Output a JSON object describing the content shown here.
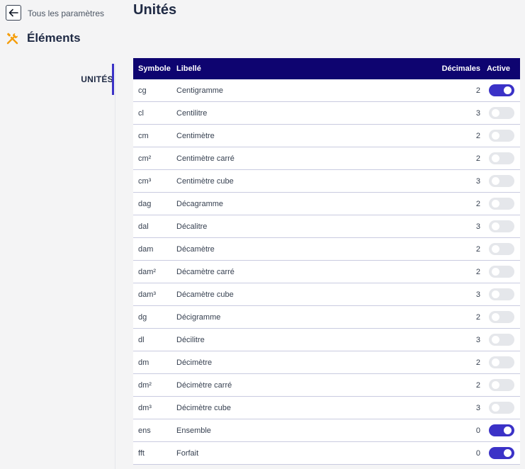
{
  "header": {
    "back_label": "Tous les paramètres",
    "page_title": "Unités",
    "section_title": "Éléments",
    "section_icon": "tools-icon"
  },
  "sidenav": {
    "items": [
      {
        "label": "UNITÉS",
        "active": true
      }
    ]
  },
  "table": {
    "columns": {
      "symbol": "Symbole",
      "label": "Libellé",
      "decimals": "Décimales",
      "active": "Active"
    },
    "rows": [
      {
        "symbol": "cg",
        "label": "Centigramme",
        "decimals": "2",
        "active": true
      },
      {
        "symbol": "cl",
        "label": "Centilitre",
        "decimals": "3",
        "active": false
      },
      {
        "symbol": "cm",
        "label": "Centimètre",
        "decimals": "2",
        "active": false
      },
      {
        "symbol": "cm²",
        "label": "Centimètre carré",
        "decimals": "2",
        "active": false
      },
      {
        "symbol": "cm³",
        "label": "Centimètre cube",
        "decimals": "3",
        "active": false
      },
      {
        "symbol": "dag",
        "label": "Décagramme",
        "decimals": "2",
        "active": false
      },
      {
        "symbol": "dal",
        "label": "Décalitre",
        "decimals": "3",
        "active": false
      },
      {
        "symbol": "dam",
        "label": "Décamètre",
        "decimals": "2",
        "active": false
      },
      {
        "symbol": "dam²",
        "label": "Décamètre carré",
        "decimals": "2",
        "active": false
      },
      {
        "symbol": "dam³",
        "label": "Décamètre cube",
        "decimals": "3",
        "active": false
      },
      {
        "symbol": "dg",
        "label": "Décigramme",
        "decimals": "2",
        "active": false
      },
      {
        "symbol": "dl",
        "label": "Décilitre",
        "decimals": "3",
        "active": false
      },
      {
        "symbol": "dm",
        "label": "Décimètre",
        "decimals": "2",
        "active": false
      },
      {
        "symbol": "dm²",
        "label": "Décimètre carré",
        "decimals": "2",
        "active": false
      },
      {
        "symbol": "dm³",
        "label": "Décimètre cube",
        "decimals": "3",
        "active": false
      },
      {
        "symbol": "ens",
        "label": "Ensemble",
        "decimals": "0",
        "active": true
      },
      {
        "symbol": "fft",
        "label": "Forfait",
        "decimals": "0",
        "active": true
      }
    ]
  },
  "colors": {
    "accent": "#3b32c7",
    "header_bg": "#0e0470",
    "toggle_off": "#e5e7eb"
  }
}
